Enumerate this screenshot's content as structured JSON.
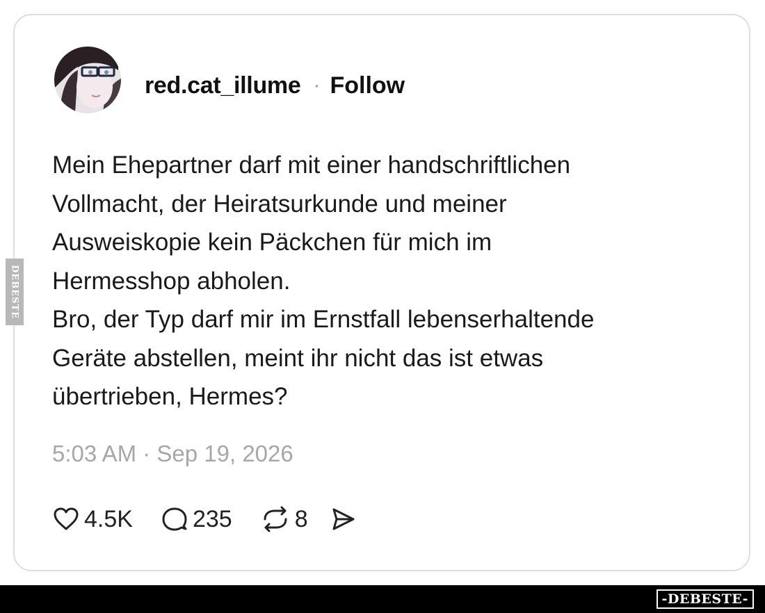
{
  "post": {
    "author": {
      "username": "red.cat_illume",
      "separator": "·",
      "follow_label": "Follow"
    },
    "text_lines": [
      "Mein Ehepartner darf mit einer handschriftlichen",
      "Vollmacht, der Heiratsurkunde und meiner",
      "Ausweiskopie kein Päckchen für mich im",
      "Hermesshop abholen.",
      "Bro, der Typ darf mir im Ernstfall lebenserhaltende",
      "Geräte abstellen, meint ihr nicht das ist etwas",
      "übertrieben, Hermes?"
    ],
    "timestamp": "5:03 AM · Sep 19, 2026",
    "actions": {
      "like": {
        "icon": "heart-icon",
        "count": "4.5K"
      },
      "reply": {
        "icon": "comment-bubble-icon",
        "count": "235"
      },
      "repost": {
        "icon": "repost-icon",
        "count": "8"
      },
      "share": {
        "icon": "send-icon"
      }
    }
  },
  "watermark": {
    "side_text": "DEBESTE",
    "footer_text": "-DEBESTE-"
  },
  "colors": {
    "text": "#1a1a1a",
    "muted": "#a7a7a7",
    "card_border": "#dedede",
    "footer_bar": "#000000"
  }
}
